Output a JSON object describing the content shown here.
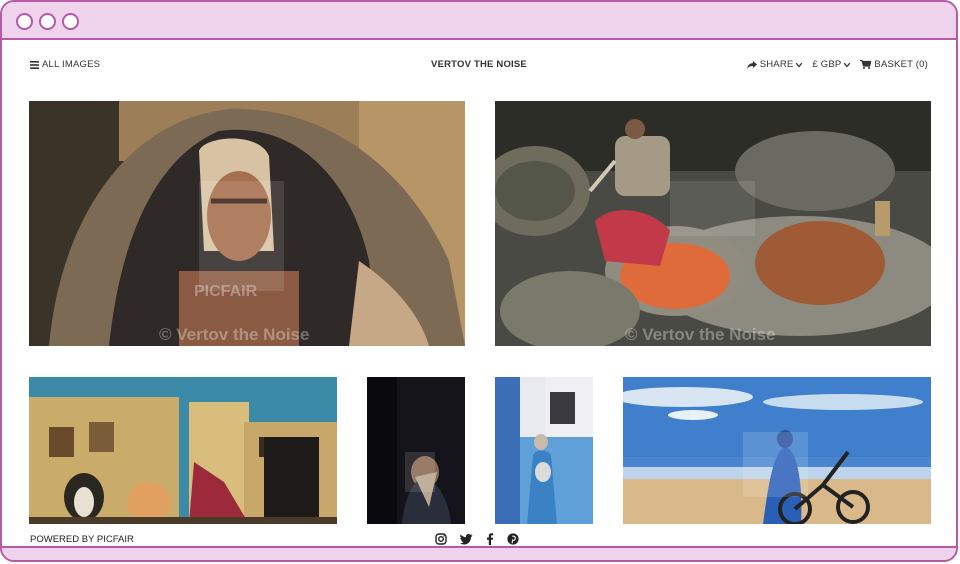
{
  "nav": {
    "all_images": "ALL IMAGES",
    "site_title": "VERTOV THE NOISE",
    "share": "SHARE",
    "currency": "£ GBP",
    "basket": "BASKET (0)"
  },
  "watermark": {
    "brand": "PICFAIR",
    "credit": "© Vertov the Noise"
  },
  "photos": [
    {
      "label": "Man wrapped in blanket"
    },
    {
      "label": "Tannery worker with dyed wool"
    },
    {
      "label": "Street with cats"
    },
    {
      "label": "Figure in shadow"
    },
    {
      "label": "Woman in blue street"
    },
    {
      "label": "Person with motorbike in desert"
    }
  ],
  "footer": {
    "powered_by": "POWERED BY PICFAIR",
    "social_icons": [
      "instagram-icon",
      "twitter-icon",
      "facebook-icon",
      "pinterest-icon"
    ]
  },
  "colors": {
    "window_border": "#b55aa5",
    "window_bar": "#efd2eb"
  }
}
